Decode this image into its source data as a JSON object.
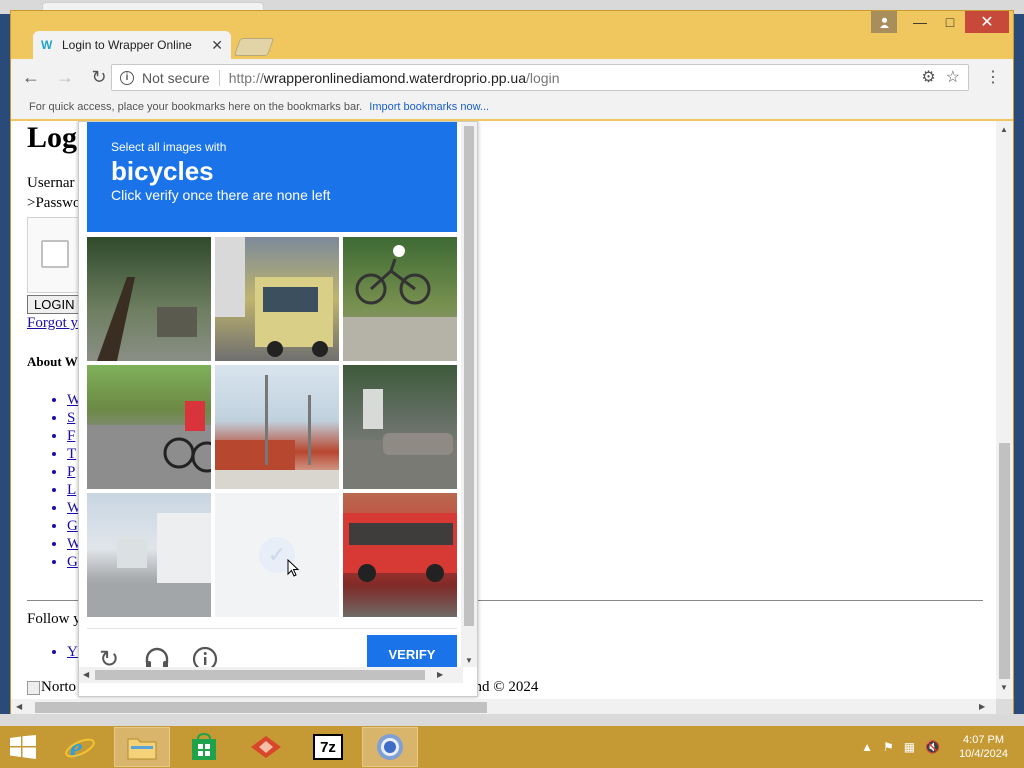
{
  "browser": {
    "tab_title": "Login to Wrapper Online",
    "tab_favicon": "W",
    "address_info_label": "Not secure",
    "url_prefix": "http://",
    "url_host": "wrapperonlinediamond.waterdroprio.pp.ua",
    "url_path": "/login",
    "bookmarks_text": "For quick access, place your bookmarks here on the bookmarks bar.",
    "bookmarks_link": "Import bookmarks now..."
  },
  "page": {
    "heading": "Log",
    "username_label": "Usernar",
    "password_label": ">Passwo",
    "login_button": "LOGIN",
    "forgot_link": "Forgot y",
    "about_heading": "About W",
    "about_links": [
      "W",
      "S",
      "F",
      "T",
      "P",
      "L",
      "W",
      "G",
      "W",
      "G"
    ],
    "follow_text": "Follow y",
    "follow_links": [
      "Y"
    ],
    "footer_img_alt": "Norto",
    "footer_copyright": "ond © 2024"
  },
  "captcha": {
    "instruction_small": "Select all images with",
    "instruction_target": "bicycles",
    "instruction_sub": "Click verify once there are none left",
    "verify_label": "VERIFY",
    "tiles": [
      {
        "name": "tile-trees-sidewalk"
      },
      {
        "name": "tile-truck"
      },
      {
        "name": "tile-bicycle-rider"
      },
      {
        "name": "tile-bicycle-road"
      },
      {
        "name": "tile-building-poles"
      },
      {
        "name": "tile-parked-cars"
      },
      {
        "name": "tile-houses"
      },
      {
        "name": "tile-loading"
      },
      {
        "name": "tile-red-bus"
      }
    ]
  },
  "taskbar": {
    "apps": [
      "internet-explorer-icon",
      "file-explorer-icon",
      "store-icon",
      "app-red-icon",
      "7zip-icon",
      "chrome-icon"
    ],
    "sevenzip_label": "7z",
    "time": "4:07 PM",
    "date": "10/4/2024"
  },
  "colors": {
    "window_frame": "#f0c75e",
    "captcha_blue": "#1a73e8",
    "taskbar": "#c59a35"
  }
}
